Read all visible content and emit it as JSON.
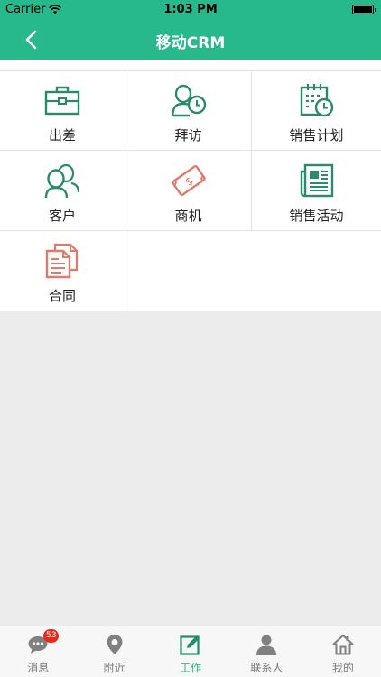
{
  "status_bar": {
    "carrier": "Carrier",
    "time": "1:03 PM"
  },
  "nav": {
    "title": "移动CRM"
  },
  "grid_items": [
    {
      "label": "出差",
      "icon": "briefcase-icon"
    },
    {
      "label": "拜访",
      "icon": "visit-clock-icon"
    },
    {
      "label": "销售计划",
      "icon": "calendar-clock-icon"
    },
    {
      "label": "客户",
      "icon": "customers-icon"
    },
    {
      "label": "商机",
      "icon": "money-icon"
    },
    {
      "label": "销售活动",
      "icon": "newspaper-icon"
    },
    {
      "label": "合同",
      "icon": "documents-icon"
    }
  ],
  "tabs": [
    {
      "label": "消息",
      "icon": "chat-icon",
      "badge": "53"
    },
    {
      "label": "附近",
      "icon": "location-pin-icon"
    },
    {
      "label": "工作",
      "icon": "edit-icon",
      "active": true
    },
    {
      "label": "联系人",
      "icon": "person-icon"
    },
    {
      "label": "我的",
      "icon": "home-icon"
    }
  ],
  "colors": {
    "accent": "#27b98c",
    "icon_green": "#2b8a6a",
    "icon_red": "#e27a6c",
    "badge": "#e8291c"
  }
}
